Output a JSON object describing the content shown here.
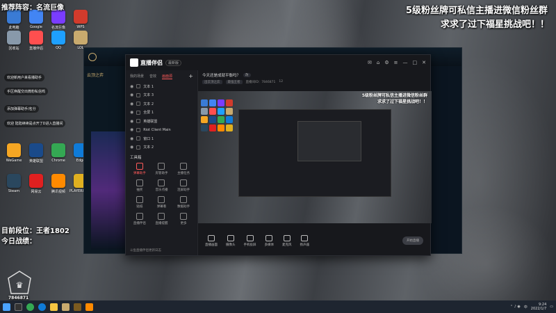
{
  "overlay": {
    "top_left": "推荐阵容：",
    "top_left_brand": "名流巨像",
    "top_right_line1": "5级粉丝牌可私信主播进微信粉丝群",
    "top_right_line2": "求求了过下福星挑战吧！！",
    "rank": "目前段位：王者1802",
    "today": "今日战绩：",
    "room_id": "7846871"
  },
  "chat": [
    "欢迎新用户来看播助手",
    "手区唤醒交出微粉私信鸣",
    "添加弹幕助手/名分",
    "欢迎 陆陆续续是点开了D进入直播间"
  ],
  "desktop_icons": [
    {
      "label": "此电脑",
      "color": "#3a7bd5"
    },
    {
      "label": "Google",
      "color": "#4285f4"
    },
    {
      "label": "名流巨像",
      "color": "#7a3cff"
    },
    {
      "label": "WPS",
      "color": "#d23b2c"
    },
    {
      "label": "回收站",
      "color": "#8899aa"
    },
    {
      "label": "直播伴侣",
      "color": "#ff4f4f"
    },
    {
      "label": "QQ",
      "color": "#1ea0ff"
    },
    {
      "label": "LOL",
      "color": "#c8aa6e"
    },
    {
      "label": "WeGame",
      "color": "#f5a623"
    },
    {
      "label": "英雄联盟",
      "color": "#1a4a8a"
    },
    {
      "label": "Chrome",
      "color": "#34a853"
    },
    {
      "label": "Edge",
      "color": "#0f7bd8"
    },
    {
      "label": "Steam",
      "color": "#2a475e"
    },
    {
      "label": "网易云",
      "color": "#e02020"
    },
    {
      "label": "腾讯视频",
      "color": "#ff8a00"
    },
    {
      "label": "PLAYERUNKNOWN",
      "color": "#e0b020"
    }
  ],
  "game_client": {
    "title": "云顶之弈",
    "currency": "7400"
  },
  "app": {
    "name": "直播伴侣",
    "version": "最新版",
    "tabs": [
      "我的场景",
      "音效",
      "画面源"
    ],
    "active_tab": "画面源",
    "sources": [
      "文本 1",
      "文本 3",
      "文本 2",
      "全屏 1",
      "英雄联盟",
      "Riot Client Main",
      "窗口 1",
      "文本 2"
    ],
    "tools_title": "工具箱",
    "tools": [
      "弹幕助手",
      "房管助手",
      "主播任务",
      "抽奖",
      "音乐点播",
      "连屏助手",
      "贴纸",
      "弹幕看",
      "数据助手",
      "直播伴侣",
      "直播提醒",
      "更多"
    ],
    "stream_title": "今天还是成就平衡吗？",
    "stream_tag": "改",
    "meta": [
      "出云顶之弈",
      "最强王者",
      "直播间ID：7846871",
      "12"
    ],
    "preview_text_1": "5级粉丝牌可私信主播进微信粉丝群",
    "preview_text_2": "求求了过下福星挑战吧！！",
    "controls": [
      "直播画面",
      "摄像头",
      "手机投屏",
      "多媒体",
      "麦克风",
      "扬声器"
    ],
    "start_button": "开始直播",
    "footer_note": "斗鱼直播伴侣更新日志"
  },
  "taskbar": {
    "time": "9:24",
    "date": "2022/1/7",
    "lang": "中"
  },
  "colors": {
    "accent": "#ff5a5a",
    "app_bg": "#17181c",
    "panel_bg": "#1b1c21",
    "taskbar_bg": "#1e2530"
  }
}
